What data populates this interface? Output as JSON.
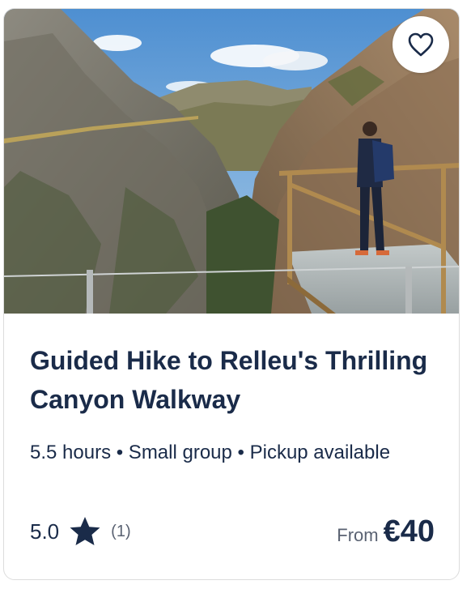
{
  "card": {
    "image_alt": "Hiker standing on a glass viewing platform above a canyon",
    "favorite_icon": "heart-icon",
    "title": "Guided Hike to Relleu's Thrilling Canyon Walkway",
    "meta": "5.5 hours • Small group • Pickup available",
    "rating": {
      "value": "5.0",
      "icon": "star-icon",
      "count": "(1)"
    },
    "price": {
      "from_label": "From",
      "amount": "€40"
    }
  },
  "colors": {
    "text_primary": "#1a2b49",
    "text_secondary": "#5a6272",
    "border": "#dcdcdc"
  }
}
